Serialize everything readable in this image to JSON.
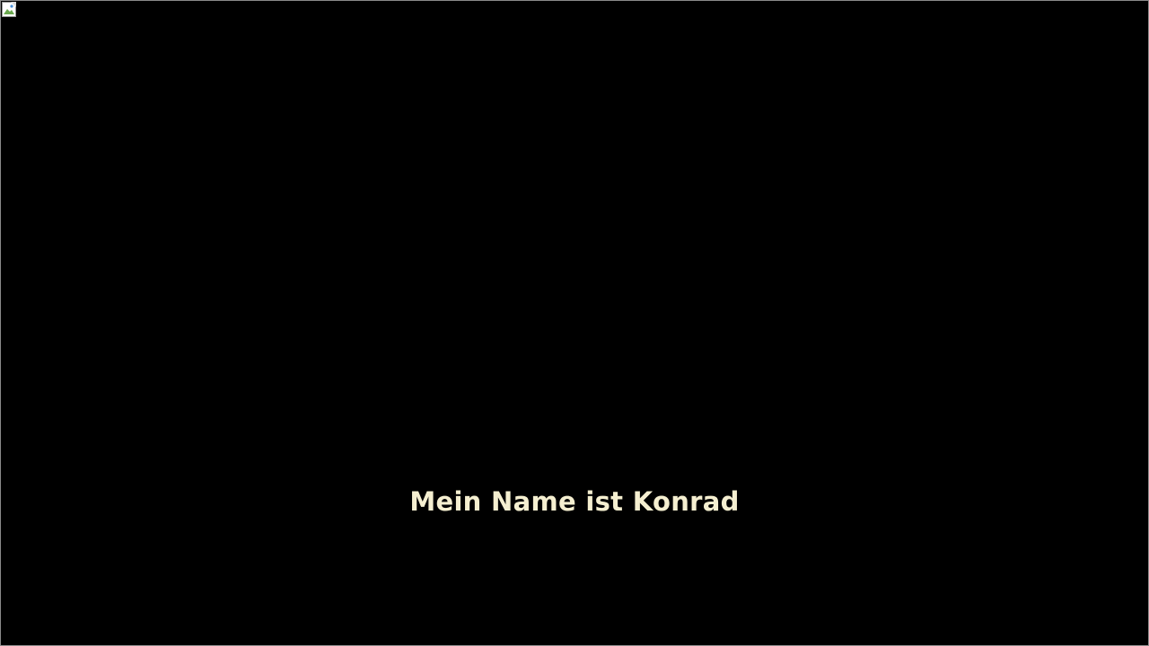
{
  "video": {
    "poster_icon": "broken-image-icon",
    "background_color": "#000000"
  },
  "subtitle": {
    "text": "Mein Name ist Konrad",
    "color": "#f5efd0"
  }
}
